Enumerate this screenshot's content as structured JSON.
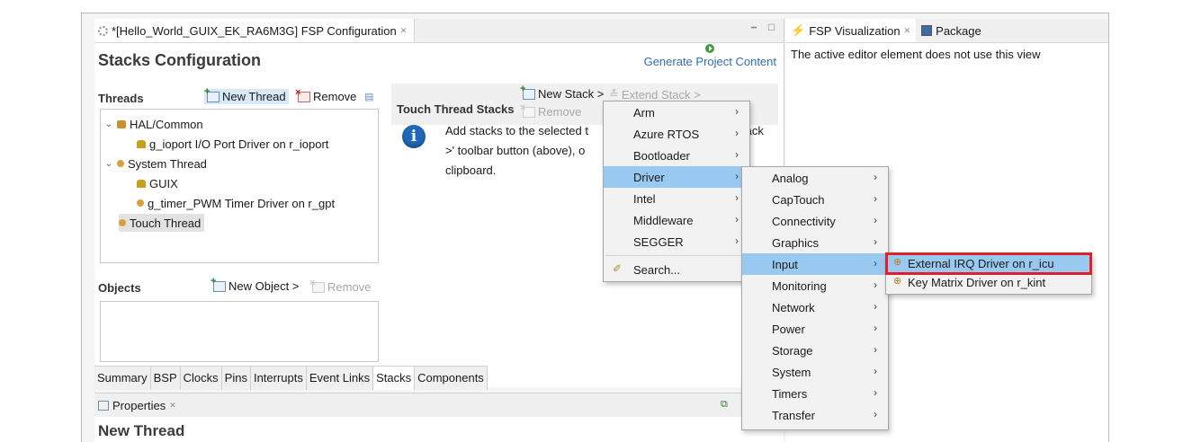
{
  "editor": {
    "tab_title": "*[Hello_World_GUIX_EK_RA6M3G] FSP Configuration",
    "heading": "Stacks Configuration",
    "generate_label": "Generate Project Content"
  },
  "threads": {
    "title": "Threads",
    "new_thread": "New Thread",
    "remove": "Remove",
    "tree": [
      {
        "label": "HAL/Common"
      },
      {
        "label": "g_ioport I/O Port Driver on r_ioport"
      },
      {
        "label": "System Thread"
      },
      {
        "label": "GUIX"
      },
      {
        "label": "g_timer_PWM Timer Driver on r_gpt"
      },
      {
        "label": "Touch Thread"
      }
    ]
  },
  "objects": {
    "title": "Objects",
    "new_object": "New Object >",
    "remove": "Remove"
  },
  "stacks": {
    "title": "Touch Thread Stacks",
    "new_stack": "New Stack >",
    "extend_stack": "Extend Stack >",
    "remove": "Remove",
    "info_line1": "Add stacks to the selected t",
    "info_line1_end": "tack",
    "info_line2": ">' toolbar button (above), o",
    "info_line3": "clipboard."
  },
  "bottom_tabs": [
    "Summary",
    "BSP",
    "Clocks",
    "Pins",
    "Interrupts",
    "Event Links",
    "Stacks",
    "Components"
  ],
  "properties": {
    "tab": "Properties",
    "title": "New Thread"
  },
  "right_pane": {
    "tab1": "FSP Visualization",
    "tab2": "Package",
    "message": "The active editor element does not use this view"
  },
  "menu1": {
    "items": [
      "Arm",
      "Azure RTOS",
      "Bootloader",
      "Driver",
      "Intel",
      "Middleware",
      "SEGGER"
    ],
    "search": "Search..."
  },
  "menu2": {
    "items": [
      "Analog",
      "CapTouch",
      "Connectivity",
      "Graphics",
      "Input",
      "Monitoring",
      "Network",
      "Power",
      "Storage",
      "System",
      "Timers",
      "Transfer"
    ]
  },
  "menu3": {
    "items": [
      "External IRQ Driver on r_icu",
      "Key Matrix Driver on r_kint"
    ]
  },
  "colors": {
    "highlight": "#99c9f0",
    "callout": "#e0202a",
    "link": "#2f6fb0"
  }
}
